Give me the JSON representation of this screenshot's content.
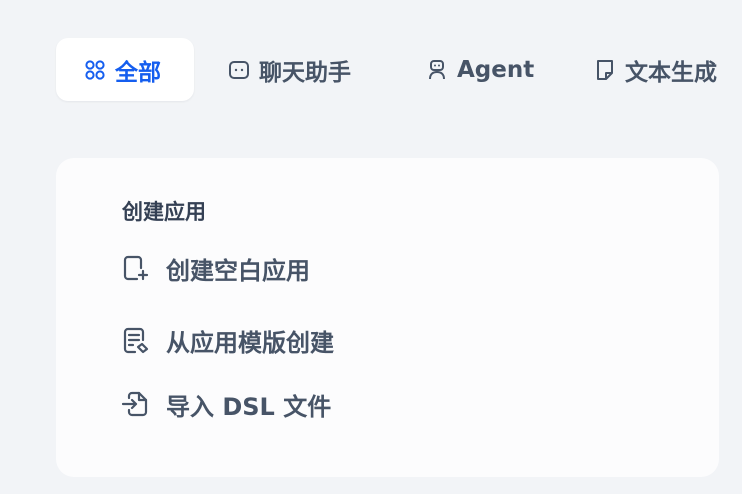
{
  "tabs": [
    {
      "label": "全部",
      "icon": "grid-icon",
      "active": true
    },
    {
      "label": "聊天助手",
      "icon": "chat-icon",
      "active": false
    },
    {
      "label": "Agent",
      "icon": "robot-icon",
      "active": false
    },
    {
      "label": "文本生成",
      "icon": "note-icon",
      "active": false
    }
  ],
  "create_card": {
    "title": "创建应用",
    "actions": [
      {
        "label": "创建空白应用",
        "icon": "file-plus-icon"
      },
      {
        "label": "从应用模版创建",
        "icon": "template-icon"
      },
      {
        "label": "导入 DSL 文件",
        "icon": "file-import-icon"
      }
    ]
  },
  "colors": {
    "accent": "#155eef",
    "text": "#475467",
    "background": "#f2f4f7",
    "card": "#fcfcfd"
  }
}
